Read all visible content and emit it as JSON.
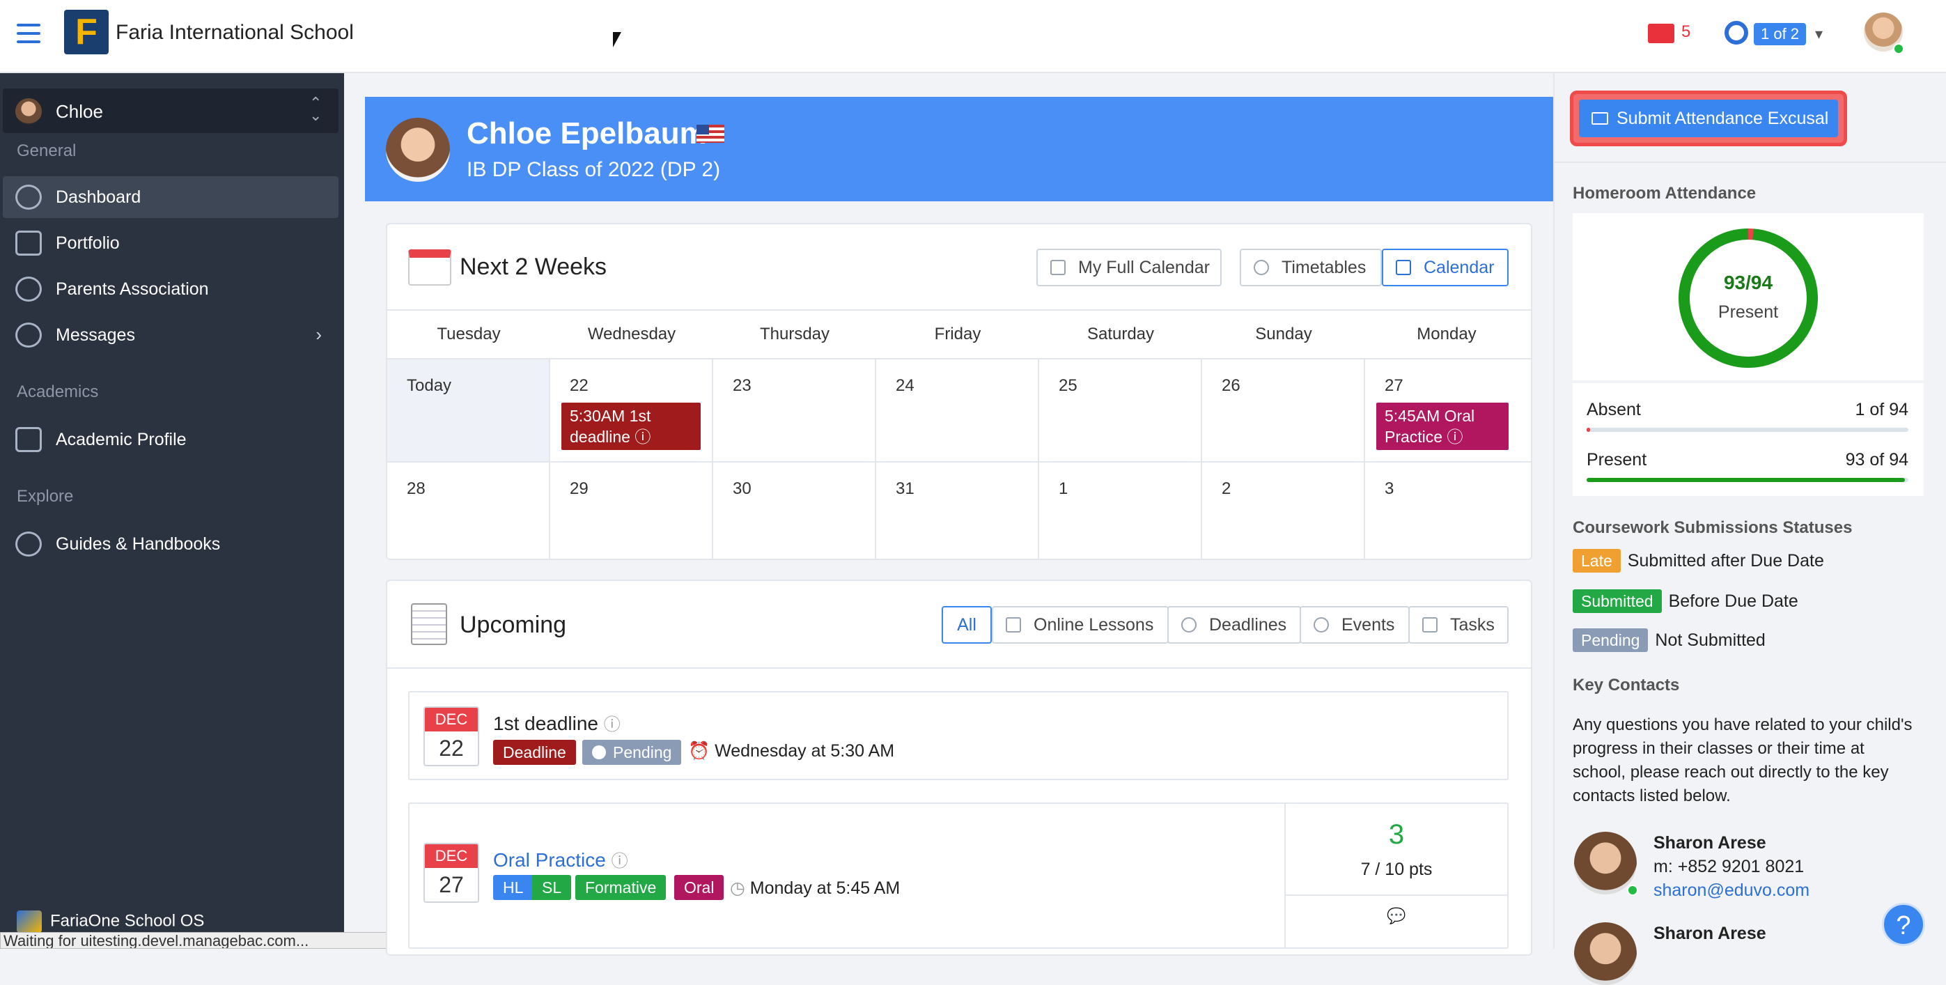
{
  "header": {
    "school_name": "Faria International School",
    "logo_letter": "F",
    "mail_count": "5",
    "children_pager": "1 of 2"
  },
  "sidebar": {
    "student": "Chloe",
    "section_general": "General",
    "items_general": [
      {
        "label": "Dashboard",
        "icon": "dashboard-icon"
      },
      {
        "label": "Portfolio",
        "icon": "briefcase-icon"
      },
      {
        "label": "Parents Association",
        "icon": "people-icon"
      },
      {
        "label": "Messages",
        "icon": "chat-icon"
      }
    ],
    "section_academics": "Academics",
    "academic_profile": "Academic Profile",
    "section_explore": "Explore",
    "guides": "Guides & Handbooks",
    "footer": "FariaOne School OS"
  },
  "status_bar": "Waiting for uitesting.devel.managebac.com...",
  "profile": {
    "name": "Chloe Epelbaum",
    "class": "IB DP Class of 2022 (DP 2)"
  },
  "calendar": {
    "title": "Next 2 Weeks",
    "buttons": {
      "full": "My Full Calendar",
      "timetables": "Timetables",
      "calendar": "Calendar"
    },
    "days": [
      "Tuesday",
      "Wednesday",
      "Thursday",
      "Friday",
      "Saturday",
      "Sunday",
      "Monday"
    ],
    "week1": [
      "Today",
      "22",
      "23",
      "24",
      "25",
      "26",
      "27"
    ],
    "week2": [
      "28",
      "29",
      "30",
      "31",
      "1",
      "2",
      "3"
    ],
    "event1": "5:30AM 1st deadline",
    "event2": "5:45AM Oral Practice"
  },
  "upcoming": {
    "title": "Upcoming",
    "filters": [
      "All",
      "Online Lessons",
      "Deadlines",
      "Events",
      "Tasks"
    ],
    "item1": {
      "month": "DEC",
      "day": "22",
      "title": "1st deadline",
      "tag_type": "Deadline",
      "tag_status": "Pending",
      "when": "Wednesday at 5:30 AM"
    },
    "item2": {
      "month": "DEC",
      "day": "27",
      "title": "Oral Practice",
      "tags": [
        "HL",
        "SL",
        "Formative",
        "Oral"
      ],
      "when": "Monday at 5:45 AM",
      "grade": "3",
      "points": "7 / 10 pts"
    }
  },
  "right": {
    "excusal_button": "Submit Attendance Excusal",
    "homeroom_title": "Homeroom Attendance",
    "donut_value": "93/94",
    "donut_label": "Present",
    "absent_label": "Absent",
    "absent_value": "1 of 94",
    "present_label": "Present",
    "present_value": "93 of 94",
    "absent_fraction": 0.0106,
    "present_fraction": 0.9894,
    "coursework_title": "Coursework Submissions Statuses",
    "legend": [
      {
        "badge": "Late",
        "text": "Submitted after Due Date",
        "color": "#f0a030"
      },
      {
        "badge": "Submitted",
        "text": "Before Due Date",
        "color": "#22a845"
      },
      {
        "badge": "Pending",
        "text": "Not Submitted",
        "color": "#8a9bb5"
      }
    ],
    "contacts_title": "Key Contacts",
    "contacts_text": "Any questions you have related to your child's progress in their classes or their time at school, please reach out directly to the key contacts listed below.",
    "contact1": {
      "name": "Sharon Arese",
      "phone": "m: +852 9201 8021",
      "email": "sharon@eduvo.com"
    },
    "contact2": {
      "name": "Sharon Arese"
    }
  },
  "help": "?"
}
